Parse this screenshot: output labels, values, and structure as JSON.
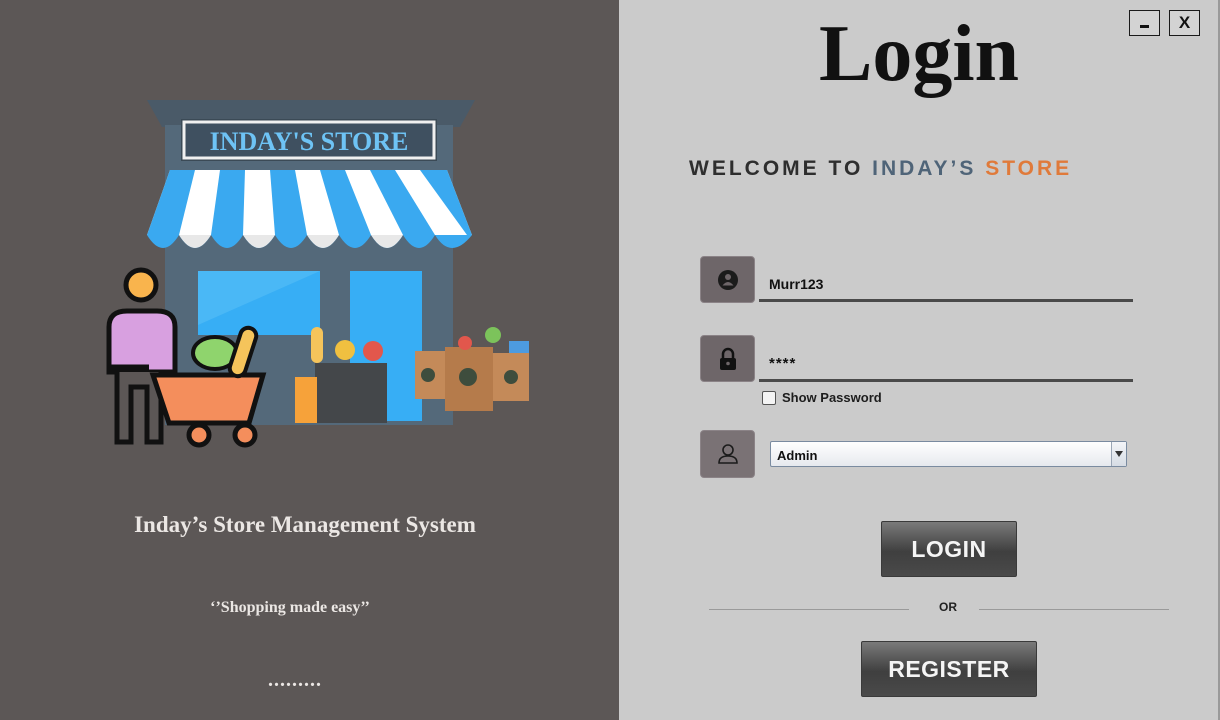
{
  "left_panel": {
    "store_sign": "INDAY'S STORE",
    "app_title": "Inday’s Store Management System",
    "tagline": "‘’Shopping made easy’’",
    "dots": "........."
  },
  "window_controls": {
    "minimize_label": "",
    "close_label": "X"
  },
  "login": {
    "title": "Login",
    "welcome_prefix": "WELCOME TO ",
    "welcome_brand": "INDAY’S ",
    "welcome_store": "STORE",
    "username_value": "Murr123",
    "password_value": "****",
    "show_password_label": "Show Password",
    "role_selected": "Admin",
    "login_button": "LOGIN",
    "or_text": "OR",
    "register_button": "REGISTER"
  },
  "icons": {
    "username": "user-icon",
    "password": "lock-icon",
    "role": "person-icon"
  },
  "colors": {
    "left_background": "#5c5756",
    "right_background": "#cbcbcb",
    "brand_blue": "#4f6478",
    "brand_orange": "#e07a3a",
    "awning_blue": "#3aa9f0"
  }
}
